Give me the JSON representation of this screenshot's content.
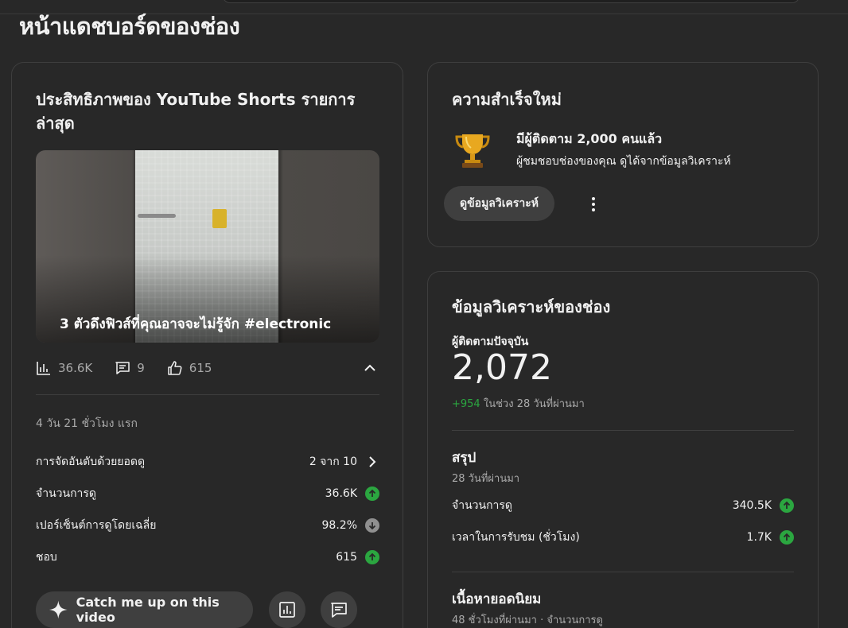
{
  "page": {
    "title": "หน้าแดชบอร์ดของช่อง"
  },
  "shorts_card": {
    "title": "ประสิทธิภาพของ YouTube Shorts รายการล่าสุด",
    "thumbnail_caption": "3 ตัวดึงฟิวส์ที่คุณอาจจะไม่รู้จัก #electronic",
    "stats": {
      "views": "36.6K",
      "comments": "9",
      "likes": "615"
    },
    "age": "4 วัน 21 ชั่วโมง แรก",
    "metrics": [
      {
        "label": "การจัดอันดับด้วยยอดดู",
        "value": "2 จาก 10",
        "trend": "chevron"
      },
      {
        "label": "จำนวนการดู",
        "value": "36.6K",
        "trend": "up"
      },
      {
        "label": "เปอร์เซ็นต์การดูโดยเฉลี่ย",
        "value": "98.2%",
        "trend": "down"
      },
      {
        "label": "ชอบ",
        "value": "615",
        "trend": "up"
      }
    ],
    "catch_up_button": "Catch me up on this video"
  },
  "achievement_card": {
    "title": "ความสำเร็จใหม่",
    "headline": "มีผู้ติดตาม 2,000 คนแล้ว",
    "subtext": "ผู้ชมชอบช่องของคุณ ดูได้จากข้อมูลวิเคราะห์",
    "button": "ดูข้อมูลวิเคราะห์"
  },
  "analytics_card": {
    "title": "ข้อมูลวิเคราะห์ของช่อง",
    "subscribers_label": "ผู้ติดตามปัจจุบัน",
    "subscribers_value": "2,072",
    "subscribers_change": "+954",
    "subscribers_change_period": "ในช่วง 28 วันที่ผ่านมา",
    "summary_title": "สรุป",
    "summary_period": "28 วันที่ผ่านมา",
    "summary_metrics": [
      {
        "label": "จำนวนการดู",
        "value": "340.5K",
        "trend": "up"
      },
      {
        "label": "เวลาในการรับชม (ชั่วโมง)",
        "value": "1.7K",
        "trend": "up"
      }
    ],
    "top_content_title": "เนื้อหายอดนิยม",
    "top_content_sub": "48 ชั่วโมงที่ผ่านมา · จำนวนการดู"
  },
  "colors": {
    "background": "#282828",
    "positive": "#2ba640",
    "neutral_down": "#909090",
    "button_bg": "#3f3f3f"
  }
}
